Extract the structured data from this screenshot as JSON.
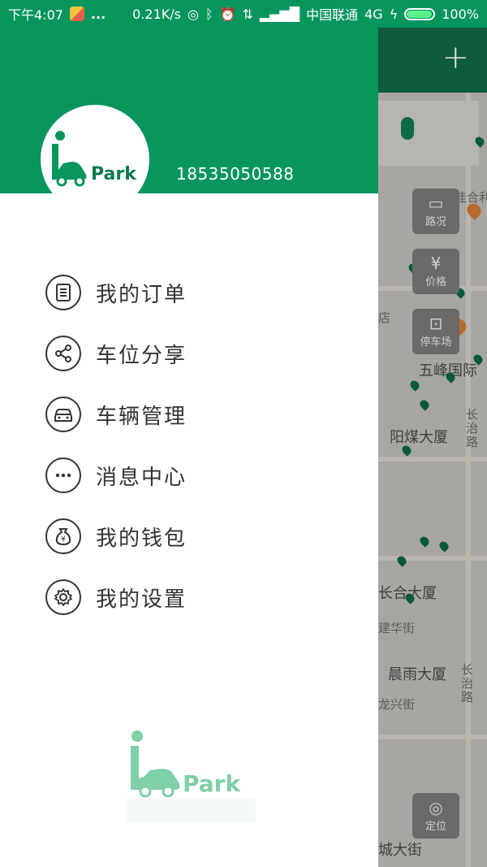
{
  "status_bar": {
    "time": "下午4:07",
    "dots": "...",
    "speed": "0.21K/s",
    "carrier": "中国联通",
    "network": "4G",
    "battery": "100%"
  },
  "drawer": {
    "phone": "18535050588",
    "logo_text": "Park",
    "menu": [
      {
        "label": "我的订单",
        "icon": "order-list-icon"
      },
      {
        "label": "车位分享",
        "icon": "share-icon"
      },
      {
        "label": "车辆管理",
        "icon": "car-icon"
      },
      {
        "label": "消息中心",
        "icon": "message-icon"
      },
      {
        "label": "我的钱包",
        "icon": "wallet-icon"
      },
      {
        "label": "我的设置",
        "icon": "settings-gear-icon"
      }
    ]
  },
  "map": {
    "buttons": {
      "traffic": "路况",
      "price": "价格",
      "parking": "停车场",
      "locate": "定位"
    },
    "labels": {
      "l1": "佳合利亚",
      "l2": "店",
      "l3": "五峰国际",
      "l4": "阳煤大厦",
      "l5": "长治路",
      "l6": "长合大厦",
      "l7": "建华街",
      "l8": "晨雨大厦",
      "l9": "长治路",
      "l10": "龙兴街",
      "l11": "城大街"
    }
  },
  "colors": {
    "brand_green": "#07955e",
    "text_dark": "#333333"
  }
}
